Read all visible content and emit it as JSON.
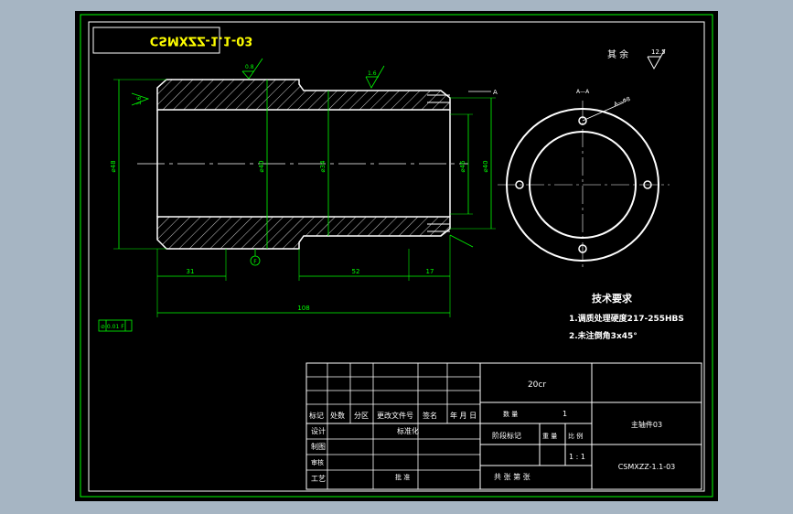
{
  "drawing": {
    "mirrored_code": "CSMXZZ-1.1-03",
    "surface_rest_label": "其 余",
    "roughness_main": "12.5",
    "roughness_a": "0.8",
    "roughness_b": "1.6",
    "roughness_c": "1.6",
    "datum_a": "A",
    "datum_label": "F",
    "geometric_tolerance": "⊘ 0.01 F",
    "section_label": "A—A",
    "section_callout": "A—Φ8",
    "dims": {
      "d_left_outer": "⌀48",
      "d_mid": "⌀40",
      "d_center": "⌀34",
      "d_right_inner": "⌀46",
      "d_right_outer": "⌀40",
      "len_31": "31",
      "len_52": "52",
      "len_17": "17",
      "len_total": "108"
    }
  },
  "notes": {
    "title": "技术要求",
    "items": [
      "1.调质处理硬度217-255HBS",
      "2.未注倒角3x45°"
    ]
  },
  "title_block": {
    "material": "20cr",
    "col_headers": [
      "标记",
      "处数",
      "分区",
      "更改文件号",
      "签名",
      "年 月 日"
    ],
    "rows": [
      "设计",
      "制图",
      "审核",
      "工艺"
    ],
    "standardization": "标准化",
    "approve": "批 准",
    "quantity_label": "数 量",
    "quantity_value": "1",
    "stage_mark": "阶段标记",
    "weight": "重 量",
    "scale": "比 例",
    "scale_value": "1 : 1",
    "sheets": "共 张 第 张",
    "part_name": "主轴件03",
    "drawing_number": "CSMXZZ-1.1-03"
  }
}
